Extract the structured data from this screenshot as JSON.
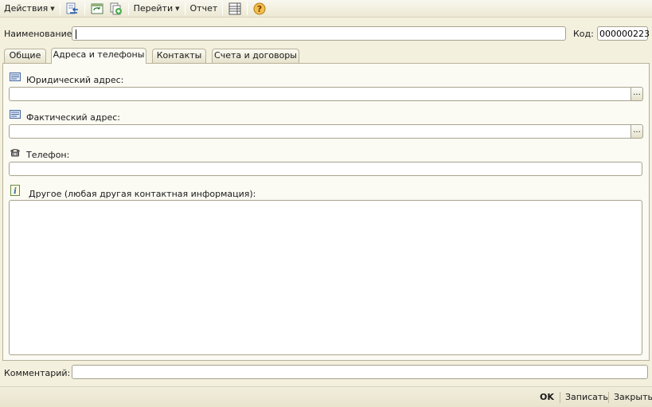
{
  "toolbar": {
    "actions_label": "Действия",
    "goto_label": "Перейти",
    "report_label": "Отчет"
  },
  "header": {
    "name_label": "Наименование:",
    "name_value": "",
    "code_label": "Код:",
    "code_value": "000000223"
  },
  "tabs": [
    {
      "label": "Общие"
    },
    {
      "label": "Адреса и телефоны"
    },
    {
      "label": "Контакты"
    },
    {
      "label": "Счета и договоры"
    }
  ],
  "main": {
    "legal_address_label": "Юридический адрес:",
    "legal_address_value": "",
    "actual_address_label": "Фактический адрес:",
    "actual_address_value": "",
    "phone_label": "Телефон:",
    "phone_value": "",
    "other_label": "Другое (любая другая контактная информация):",
    "other_value": "",
    "ellipsis": "..."
  },
  "comment": {
    "label": "Комментарий:",
    "value": ""
  },
  "footer": {
    "ok_label": "OK",
    "save_label": "Записать",
    "close_label": "Закрыть"
  },
  "colors": {
    "background": "#f3f0de",
    "panel": "#fbfaf3",
    "border": "#a7a38f",
    "help_icon": "#e0a020"
  }
}
